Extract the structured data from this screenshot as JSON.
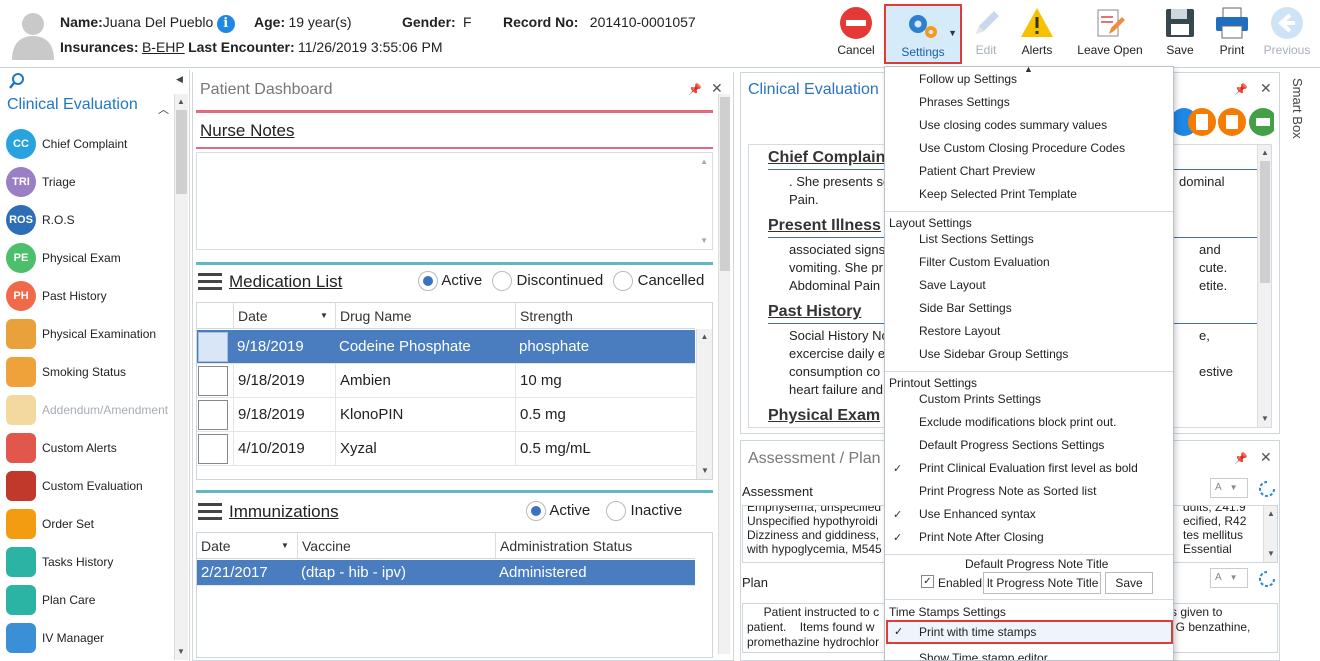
{
  "patient": {
    "name_label": "Name:",
    "name": "Juana Del Pueblo",
    "age_label": "Age:",
    "age": "19 year(s)",
    "gender_label": "Gender:",
    "gender": "F",
    "record_label": "Record No:",
    "record": "201410-0001057",
    "ins_label": "Insurances:",
    "insurance": "B-EHP",
    "last_label": "Last Encounter:",
    "last_encounter": "11/26/2019 3:55:06 PM"
  },
  "toolbar": {
    "cancel": "Cancel",
    "settings": "Settings",
    "edit": "Edit",
    "alerts": "Alerts",
    "leave_open": "Leave Open",
    "save": "Save",
    "print": "Print",
    "previous": "Previous"
  },
  "sidebar": {
    "title": "Clinical Evaluation",
    "items": [
      {
        "label": "Chief Complaint",
        "abbr": "CC",
        "color": "#29a3e0"
      },
      {
        "label": "Triage",
        "abbr": "TRI",
        "color": "#9b7fc4"
      },
      {
        "label": "R.O.S",
        "abbr": "ROS",
        "color": "#2c6fb7"
      },
      {
        "label": "Physical Exam",
        "abbr": "PE",
        "color": "#4cbf6b"
      },
      {
        "label": "Past History",
        "abbr": "PH",
        "color": "#f06a4a"
      },
      {
        "label": "Physical Examination",
        "abbr": "",
        "color": "#e9a13b"
      },
      {
        "label": "Smoking Status",
        "abbr": "",
        "color": "#f0a23a"
      },
      {
        "label": "Addendum/Amendment",
        "abbr": "",
        "color": "#f3d9a0"
      },
      {
        "label": "Custom Alerts",
        "abbr": "",
        "color": "#e2574c"
      },
      {
        "label": "Custom Evaluation",
        "abbr": "",
        "color": "#c0392b"
      },
      {
        "label": "Order Set",
        "abbr": "",
        "color": "#f39c12"
      },
      {
        "label": "Tasks History",
        "abbr": "",
        "color": "#2bb3a3"
      },
      {
        "label": "Plan Care",
        "abbr": "",
        "color": "#2bb3a3"
      },
      {
        "label": "IV Manager",
        "abbr": "",
        "color": "#3a8fd6"
      }
    ]
  },
  "dashboard": {
    "title": "Patient Dashboard",
    "nurse_notes": "Nurse Notes",
    "medication_list": "Medication List",
    "med_filters": [
      "Active",
      "Discontinued",
      "Cancelled"
    ],
    "med_columns": [
      "Date",
      "Drug Name",
      "Strength"
    ],
    "medications": [
      {
        "date": "9/18/2019",
        "drug": "Codeine Phosphate",
        "strength": "phosphate"
      },
      {
        "date": "9/18/2019",
        "drug": "Ambien",
        "strength": "10 mg"
      },
      {
        "date": "9/18/2019",
        "drug": "KlonoPIN",
        "strength": "0.5 mg"
      },
      {
        "date": "4/10/2019",
        "drug": "Xyzal",
        "strength": "0.5 mg/mL"
      }
    ],
    "immunizations": "Immunizations",
    "imm_filters": [
      "Active",
      "Inactive"
    ],
    "imm_columns": [
      "Date",
      "Vaccine",
      "Administration Status"
    ],
    "imm_rows": [
      {
        "date": "2/21/2017",
        "vaccine": "(dtap - hib - ipv)",
        "status": "Administered"
      }
    ]
  },
  "clinical": {
    "title": "Clinical Evaluation",
    "sections": [
      {
        "head": "Chief Complaint",
        "left": ". She presents se",
        "right": "dominal",
        "line2": "Pain."
      },
      {
        "head": "Present Illness",
        "left": " associated signs",
        "right": "and",
        "line2": "vomiting. She pr",
        "right2": "cute.",
        "line3": "Abdominal Pain",
        "right3": "etite."
      },
      {
        "head": "Past History",
        "left": "Social History Nc",
        "right": "e,",
        "line2": "excercise daily e",
        "line3": "consumption co",
        "right3": "estive",
        "line4": "heart failure and"
      },
      {
        "head": "Physical Exam"
      }
    ]
  },
  "assessment": {
    "title": "Assessment / Plan",
    "assessment_label": "Assessment",
    "lines": [
      "Emphysema, unspecified",
      "Unspecified hypothyroidi",
      "Dizziness and giddiness,",
      "with hypoglycemia, M545"
    ],
    "right_lines": [
      "dults, Z41.9",
      "ecified, R42",
      "tes mellitus",
      "Essential"
    ],
    "plan_label": "Plan",
    "plan_lines": [
      "     Patient instructed to c",
      "patient.    Items found w",
      "promethazine hydrochlor"
    ],
    "plan_right": [
      "ions given to",
      "illin G benzathine,",
      ""
    ]
  },
  "smart_box": "Smart Box",
  "menu": {
    "items": [
      {
        "type": "item",
        "label": "Follow up Settings"
      },
      {
        "type": "item",
        "label": "Phrases Settings"
      },
      {
        "type": "item",
        "label": "Use closing codes summary values"
      },
      {
        "type": "item",
        "label": "Use Custom Closing Procedure Codes"
      },
      {
        "type": "item",
        "label": "Patient Chart Preview"
      },
      {
        "type": "item",
        "label": "Keep Selected Print Template"
      },
      {
        "type": "head",
        "label": "Layout Settings"
      },
      {
        "type": "item",
        "label": "List Sections Settings"
      },
      {
        "type": "item",
        "label": "Filter Custom Evaluation"
      },
      {
        "type": "item",
        "label": "Save Layout"
      },
      {
        "type": "item",
        "label": "Side Bar Settings"
      },
      {
        "type": "item",
        "label": "Restore Layout"
      },
      {
        "type": "item",
        "label": "Use Sidebar Group Settings"
      },
      {
        "type": "head",
        "label": "Printout Settings"
      },
      {
        "type": "item",
        "label": "Custom Prints Settings"
      },
      {
        "type": "item",
        "label": "Exclude modifications block print out."
      },
      {
        "type": "item",
        "label": "Default Progress Sections Settings"
      },
      {
        "type": "check",
        "label": "Print Clinical Evaluation first level as bold"
      },
      {
        "type": "item",
        "label": "Print Progress Note as Sorted list"
      },
      {
        "type": "check",
        "label": "Use Enhanced syntax"
      },
      {
        "type": "check",
        "label": "Print Note After Closing"
      }
    ],
    "progress_title_label": "Default Progress Note Title",
    "enabled_label": "Enabled",
    "progress_title_value": "lt Progress Note Title",
    "save_label": "Save",
    "time_stamps_head": "Time Stamps Settings",
    "print_time_stamps": "Print with time stamps",
    "show_editor": "Show Time stamp editor"
  }
}
